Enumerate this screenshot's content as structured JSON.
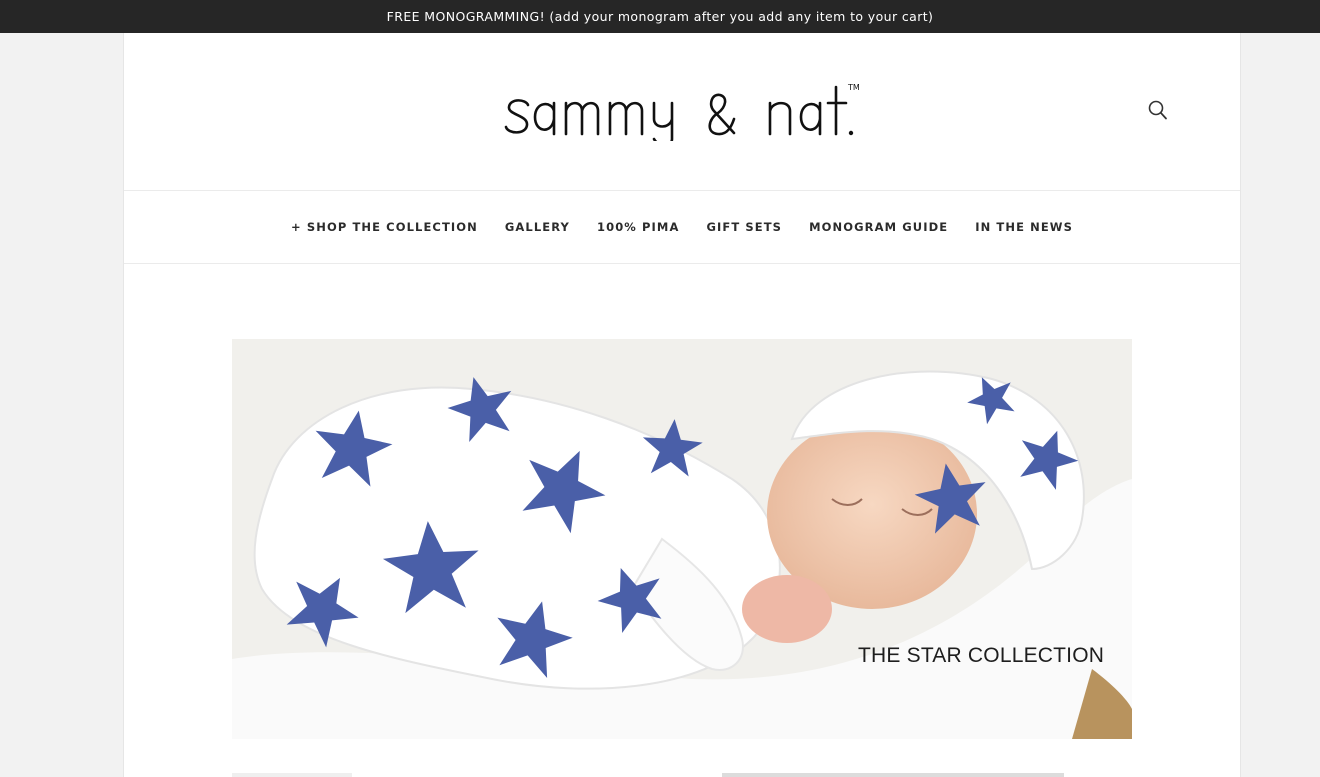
{
  "announcement": "FREE MONOGRAMMING! (add your monogram after you add any item to your cart)",
  "brand": {
    "logo_text": "sammy & nat.",
    "trademark": "TM"
  },
  "search": {
    "icon": "search-icon"
  },
  "nav": {
    "items": [
      {
        "label": "+ SHOP THE COLLECTION"
      },
      {
        "label": "GALLERY"
      },
      {
        "label": "100% PIMA"
      },
      {
        "label": "GIFT SETS"
      },
      {
        "label": "MONOGRAM GUIDE"
      },
      {
        "label": "IN THE NEWS"
      }
    ]
  },
  "hero": {
    "caption": "THE STAR COLLECTION"
  },
  "colors": {
    "announcement_bg": "#262626",
    "page_bg": "#f2f2f2",
    "star_blue": "#4a5fa8",
    "text": "#222222"
  }
}
